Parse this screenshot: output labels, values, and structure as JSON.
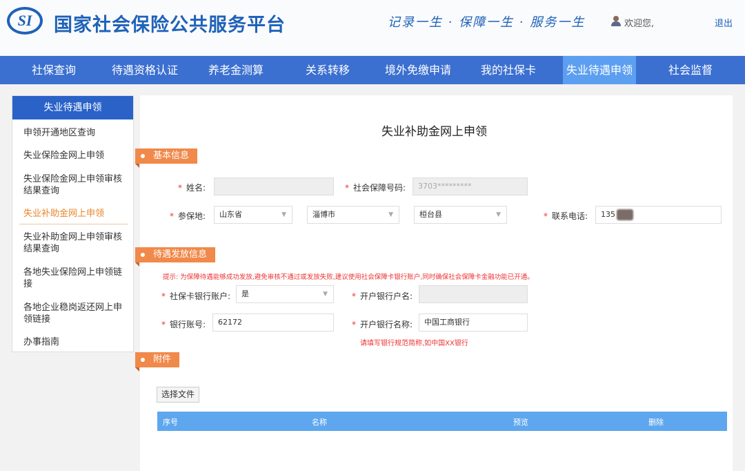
{
  "header": {
    "logo_text": "SI",
    "title": "国家社会保险公共服务平台",
    "slogan": "记录一生 · 保障一生 · 服务一生",
    "welcome": "欢迎您,",
    "logout": "退出"
  },
  "nav": {
    "items": [
      {
        "label": "社保查询"
      },
      {
        "label": "待遇资格认证"
      },
      {
        "label": "养老金测算"
      },
      {
        "label": "关系转移"
      },
      {
        "label": "境外免缴申请"
      },
      {
        "label": "我的社保卡"
      },
      {
        "label": "失业待遇申领",
        "active": true
      },
      {
        "label": "社会监督"
      }
    ]
  },
  "sidebar": {
    "title": "失业待遇申领",
    "items": [
      {
        "label": "申领开通地区查询"
      },
      {
        "label": "失业保险金网上申领"
      },
      {
        "label": "失业保险金网上申领审核结果查询"
      },
      {
        "label": "失业补助金网上申领",
        "active": true
      },
      {
        "label": "失业补助金网上申领审核结果查询"
      },
      {
        "label": "各地失业保险网上申领链接"
      },
      {
        "label": "各地企业稳岗返还网上申领链接"
      },
      {
        "label": "办事指南"
      }
    ]
  },
  "form": {
    "title": "失业补助金网上申领",
    "required_mark": "*",
    "sections": {
      "basic": "基本信息",
      "payment": "待遇发放信息",
      "attachment": "附件"
    },
    "basic": {
      "name_label": "姓名:",
      "name_value": "",
      "ssn_label": "社会保障号码:",
      "ssn_value": "3703*********",
      "region_label": "参保地:",
      "province": "山东省",
      "city": "淄博市",
      "county": "桓台县",
      "phone_label": "联系电话:",
      "phone_value": "135"
    },
    "payment": {
      "hint": "提示: 为保障待遇能够成功发放,避免审核不通过或发放失败,建议使用社会保障卡银行账户,同时确保社会保障卡金融功能已开通。",
      "card_account_label": "社保卡银行账户:",
      "card_account_value": "是",
      "account_name_label": "开户银行户名:",
      "account_name_value": "",
      "account_no_label": "银行账号:",
      "account_no_value": "62172",
      "bank_name_label": "开户银行名称:",
      "bank_name_value": "中国工商银行",
      "bank_name_hint": "请填写银行规范简称,如中国XX银行"
    },
    "attachment": {
      "choose_file": "选择文件",
      "columns": [
        "序号",
        "名称",
        "预览",
        "删除"
      ]
    }
  },
  "colors": {
    "brand": "#1f62b8",
    "nav": "#3b6fd0",
    "accent": "#f0894a",
    "error": "#e33"
  }
}
